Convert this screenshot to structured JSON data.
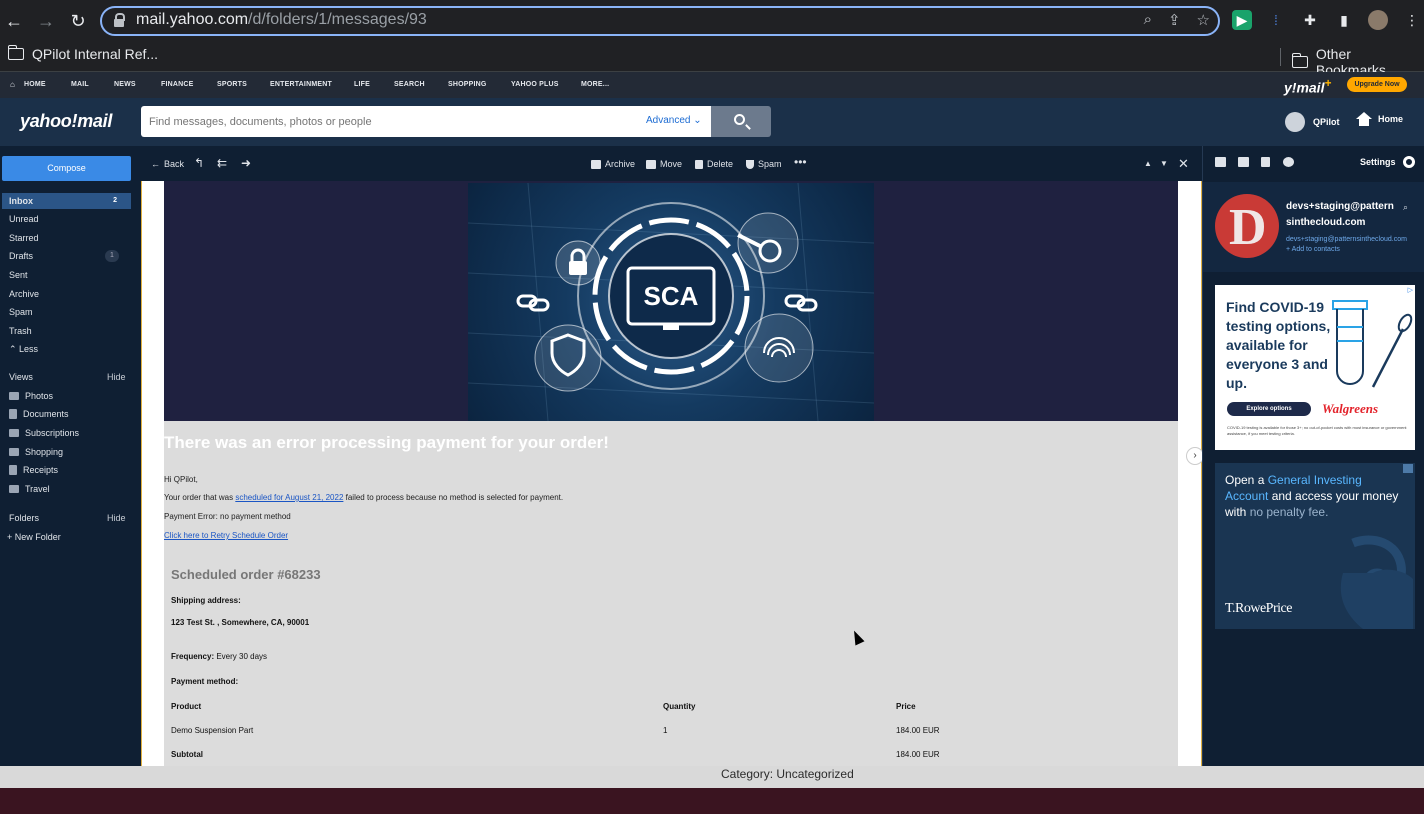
{
  "browser": {
    "url_host": "mail.yahoo.com",
    "url_path": "/d/folders/1/messages/93",
    "bookmark": "QPilot Internal Ref...",
    "other_bookmarks": "Other Bookmarks"
  },
  "yahoo_nav": [
    "HOME",
    "MAIL",
    "NEWS",
    "FINANCE",
    "SPORTS",
    "ENTERTAINMENT",
    "LIFE",
    "SEARCH",
    "SHOPPING",
    "YAHOO PLUS",
    "MORE..."
  ],
  "ymail_plus": "y!mail",
  "upgrade_label": "Upgrade Now",
  "logo": "yahoo!mail",
  "search": {
    "placeholder": "Find messages, documents, photos or people",
    "advanced": "Advanced"
  },
  "user_name": "QPilot",
  "home_label": "Home",
  "compose_label": "Compose",
  "folders": [
    {
      "label": "Inbox",
      "count": "2"
    },
    {
      "label": "Unread"
    },
    {
      "label": "Starred"
    },
    {
      "label": "Drafts",
      "count": "1"
    },
    {
      "label": "Sent"
    },
    {
      "label": "Archive"
    },
    {
      "label": "Spam"
    },
    {
      "label": "Trash"
    },
    {
      "label": "Less"
    }
  ],
  "views": {
    "title": "Views",
    "hide": "Hide",
    "items": [
      "Photos",
      "Documents",
      "Subscriptions",
      "Shopping",
      "Receipts",
      "Travel"
    ]
  },
  "folders_section": {
    "title": "Folders",
    "hide": "Hide",
    "new_folder": "New Folder"
  },
  "toolbar": {
    "back": "Back",
    "archive": "Archive",
    "move": "Move",
    "delete": "Delete",
    "spam": "Spam"
  },
  "email": {
    "banner_text": "SCA",
    "title": "There was an error processing payment for your order!",
    "greeting": "Hi QPilot,",
    "line1_pre": "Your order that was ",
    "line1_link": "scheduled for August 21, 2022",
    "line1_post": " failed to process because no method is selected for payment.",
    "error": "Payment Error: no payment method",
    "retry_link": "Click here to Retry Schedule Order",
    "scheduled": "Scheduled order #68233",
    "ship_label": "Shipping address:",
    "ship_value": "123 Test St. , Somewhere, CA, 90001",
    "freq_label": "Frequency:",
    "freq_value": " Every 30 days",
    "pay_label": "Payment method:",
    "col_product": "Product",
    "col_qty": "Quantity",
    "col_price": "Price",
    "row_product": "Demo Suspension Part",
    "row_qty": "1",
    "row_price": "184.00 EUR",
    "subtotal_label": "Subtotal",
    "subtotal_value": "184.00 EUR"
  },
  "right_panel": {
    "settings": "Settings",
    "contact_name": "devs+staging@patternsinthecloud.com",
    "contact_name_line1": "devs+staging@pattern",
    "contact_name_line2": "sinthecloud.com",
    "contact_email": "devs+staging@patternsinthecloud.com",
    "add_contact": "+ Add to contacts",
    "avatar_letter": "D"
  },
  "ads": {
    "ad1_title": "Find COVID-19 testing options, available for everyone 3 and up.",
    "ad1_button": "Explore options",
    "ad1_brand": "Walgreens",
    "ad1_fine": "COVID-19 testing is available for those 3+; no out-of-pocket costs with most insurance or government assistance, if you meet testing criteria.",
    "ad2_pre": "Open a ",
    "ad2_highlight": "General Investing Account",
    "ad2_mid": " and access your money with ",
    "ad2_dim": "no penalty fee.",
    "ad2_brand": "T.RowePrice"
  },
  "caption": {
    "label": "Category:",
    "value": " Uncategorized"
  },
  "colors": {
    "accent": "#3a8ae6",
    "nav_bg": "#0f1f33",
    "upgrade": "#ffa700"
  }
}
